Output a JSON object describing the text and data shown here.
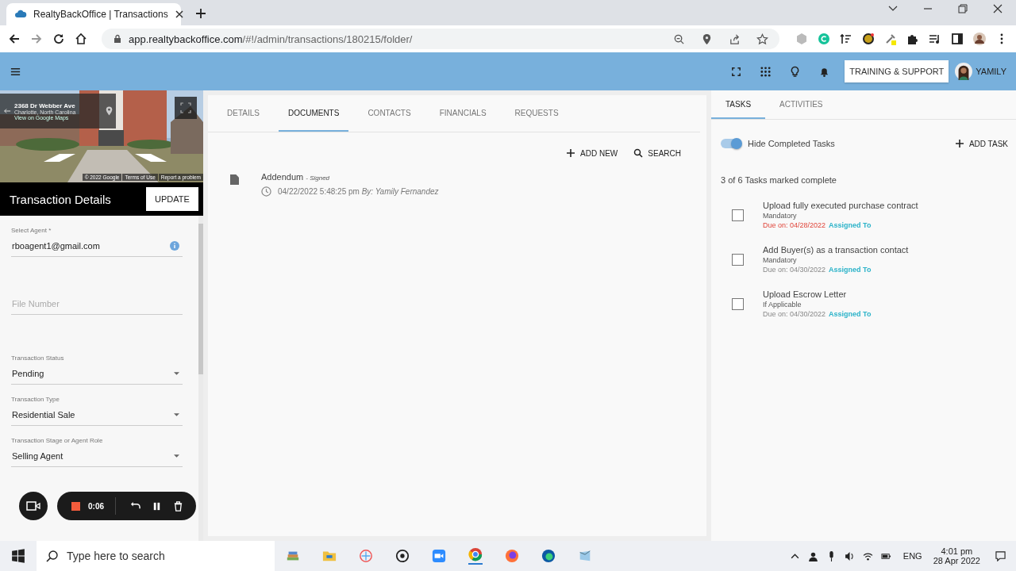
{
  "browser": {
    "tab_title": "RealtyBackOffice | Transactions",
    "url_host": "app.realtybackoffice.com",
    "url_path": "/#!/admin/transactions/180215/folder/"
  },
  "app_header": {
    "support_button": "TRAINING & SUPPORT",
    "user_name": "YAMILY"
  },
  "street_view": {
    "address": "2368 Dr Webber Ave",
    "city": "Charlotte, North Carolina",
    "link": "View on Google Maps",
    "copyright": "© 2022 Google",
    "terms": "Terms of Use",
    "report": "Report a problem"
  },
  "details": {
    "title": "Transaction Details",
    "update_button": "UPDATE",
    "fields": [
      {
        "kind": "text",
        "label": "Select Agent *",
        "value": "rboagent1@gmail.com",
        "info": true
      },
      {
        "kind": "empty",
        "placeholder": "File Number"
      },
      {
        "kind": "select",
        "label": "Transaction Status",
        "value": "Pending"
      },
      {
        "kind": "select",
        "label": "Transaction Type",
        "value": "Residential Sale"
      },
      {
        "kind": "select",
        "label": "Transaction Stage or Agent Role",
        "value": "Selling Agent"
      }
    ]
  },
  "recorder": {
    "time": "0:06"
  },
  "doc_tabs": [
    {
      "label": "DETAILS",
      "selected": false
    },
    {
      "label": "DOCUMENTS",
      "selected": true
    },
    {
      "label": "CONTACTS",
      "selected": false
    },
    {
      "label": "FINANCIALS",
      "selected": false
    },
    {
      "label": "REQUESTS",
      "selected": false
    }
  ],
  "doc_actions": [
    {
      "kind": "add",
      "label": "ADD NEW"
    },
    {
      "kind": "search",
      "label": "SEARCH"
    }
  ],
  "documents": [
    {
      "name": "Addendum",
      "status": "- Signed",
      "date": "04/22/2022 5:48:25 pm",
      "by": "By: Yamily Fernandez"
    }
  ],
  "task_tabs": [
    {
      "label": "TASKS",
      "selected": true
    },
    {
      "label": "ACTIVITIES",
      "selected": false
    }
  ],
  "hide_completed": {
    "label": "Hide Completed Tasks",
    "on": true
  },
  "add_task": "ADD TASK",
  "summary": "3 of 6 Tasks marked complete",
  "tasks": [
    {
      "title": "Upload fully executed purchase contract",
      "requirement": "Mandatory",
      "due": "Due on: 04/28/2022",
      "overdue": true,
      "assigned": "Assigned To",
      "checked": false
    },
    {
      "title": "Add Buyer(s) as a transaction contact",
      "requirement": "Mandatory",
      "due": "Due on: 04/30/2022",
      "overdue": false,
      "assigned": "Assigned To",
      "checked": false
    },
    {
      "title": "Upload Escrow Letter",
      "requirement": "If Applicable",
      "due": "Due on: 04/30/2022",
      "overdue": false,
      "assigned": "Assigned To",
      "checked": false
    }
  ],
  "taskbar": {
    "search_placeholder": "Type here to search",
    "language": "ENG",
    "time": "4:01 pm",
    "date": "28 Apr 2022"
  }
}
